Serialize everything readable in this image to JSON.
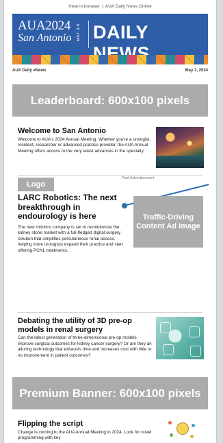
{
  "topbar": {
    "view_in_browser": "View in browser",
    "separator": "|",
    "aua_daily_news_online": "AUA Daily News Online"
  },
  "masthead": {
    "aua": "AUA2024",
    "city": "San Antonio",
    "dates": "MAY 3-6",
    "title": "DAILY NEWS"
  },
  "meta": {
    "enews": "AUA Daily eNews",
    "date": "May 3, 2024"
  },
  "banners": {
    "leaderboard": "Leaderboard: 600x100 pixels",
    "premium": "Premium Banner: 600x100 pixels"
  },
  "stories": [
    {
      "title": "Welcome to San Antonio",
      "body": "Welcome to AUA's 2024 Annual Meeting. Whether you're a urologist, resident, researcher or advanced practice provider, the AUA Annual Meeting offers access to the very latest advances in the specialty."
    },
    {
      "title": "LARC Robotics: The next breakthrough in endourology is here",
      "body": "The new robotics company is set to revolutionize the kidney stone market with a full-fledged digital surgery solution that simplifies percutaneous renal access, helping more urologists expand their practice and start offering PCNL treatments."
    },
    {
      "title": "Debating the utility of 3D pre-op models in renal surgery",
      "body": "Can the latest generation of three-dimensional pre-op models improve surgical outcomes for kidney cancer surgery? Or are they an alluring technology that exhausts time and increases cost with little or no improvement in patient outcomes?"
    },
    {
      "title": "Flipping the script",
      "body": "Change is coming to the AUA Annual Meeting in 2024. Look for novel programming with key"
    }
  ],
  "ad": {
    "paid_label": "Paid Advertisement",
    "logo": "Logo",
    "traffic": "Traffic-Driving Content Ad Image"
  },
  "colors": {
    "brand_blue": "#2f5ea8",
    "placeholder_gray": "#a9abad",
    "pointer_blue": "#2e6fb2"
  }
}
